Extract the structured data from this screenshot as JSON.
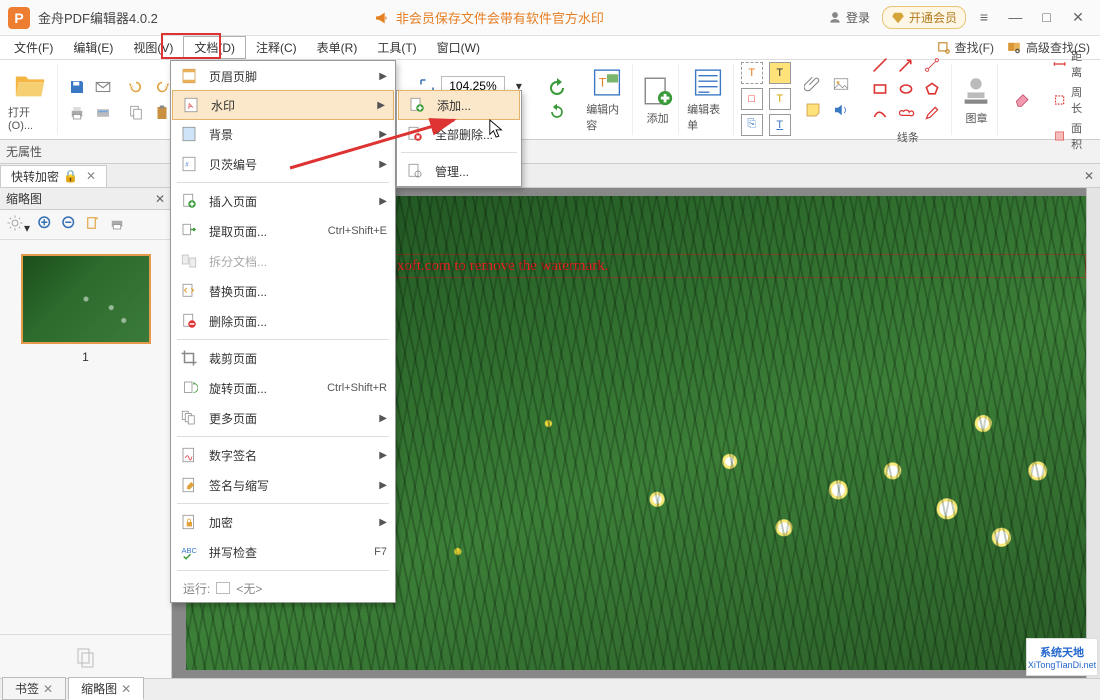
{
  "titlebar": {
    "app_title": "金舟PDF编辑器4.0.2",
    "promo_text": "非会员保存文件会带有软件官方水印",
    "login_label": "登录",
    "vip_label": "开通会员"
  },
  "menubar": {
    "items": [
      {
        "label": "文件(F)"
      },
      {
        "label": "编辑(E)"
      },
      {
        "label": "视图(V)"
      },
      {
        "label": "文档(D)"
      },
      {
        "label": "注释(C)"
      },
      {
        "label": "表单(R)"
      },
      {
        "label": "工具(T)"
      },
      {
        "label": "窗口(W)"
      }
    ],
    "find_label": "查找(F)",
    "advfind_label": "高级查找(S)"
  },
  "toolbar": {
    "open_label": "打开(O)...",
    "zoom_value": "104.25%",
    "edit_content_label": "编辑内容",
    "add_label": "添加",
    "edit_form_label": "编辑表单",
    "lines_label": "线条",
    "stamp_label": "图章",
    "distance_label": "距离",
    "perimeter_label": "周长",
    "area_label": "面积"
  },
  "propbar": {
    "text": "无属性"
  },
  "quickbar": {
    "tab_label": "快转加密"
  },
  "sidebar": {
    "head_label": "缩略图",
    "thumb_number": "1"
  },
  "document_menu": {
    "items": [
      {
        "icon": "header-footer",
        "label": "页眉页脚",
        "arrow": true
      },
      {
        "icon": "watermark",
        "label": "水印",
        "arrow": true,
        "selected": true
      },
      {
        "icon": "background",
        "label": "背景",
        "arrow": true
      },
      {
        "icon": "bates",
        "label": "贝茨编号",
        "arrow": true
      },
      {
        "sep": true
      },
      {
        "icon": "insert-page",
        "label": "插入页面",
        "arrow": true
      },
      {
        "icon": "extract-page",
        "label": "提取页面...",
        "shortcut": "Ctrl+Shift+E"
      },
      {
        "icon": "split-doc",
        "label": "拆分文档...",
        "disabled": true
      },
      {
        "icon": "replace-page",
        "label": "替换页面..."
      },
      {
        "icon": "delete-page",
        "label": "删除页面..."
      },
      {
        "sep": true
      },
      {
        "icon": "crop-page",
        "label": "裁剪页面"
      },
      {
        "icon": "rotate-page",
        "label": "旋转页面...",
        "shortcut": "Ctrl+Shift+R"
      },
      {
        "icon": "more-pages",
        "label": "更多页面",
        "arrow": true
      },
      {
        "sep": true
      },
      {
        "icon": "signature",
        "label": "数字签名",
        "arrow": true
      },
      {
        "icon": "initials",
        "label": "签名与缩写",
        "arrow": true
      },
      {
        "sep": true
      },
      {
        "icon": "encrypt",
        "label": "加密",
        "arrow": true
      },
      {
        "icon": "spellcheck",
        "label": "拼写检查",
        "shortcut": "F7"
      }
    ],
    "run_label": "运行:",
    "run_value": "<无>"
  },
  "watermark_submenu": {
    "items": [
      {
        "icon": "add",
        "label": "添加...",
        "hover": true
      },
      {
        "icon": "delete-all",
        "label": "全部删除..."
      },
      {
        "sep": true
      },
      {
        "icon": "manage",
        "label": "管理..."
      }
    ]
  },
  "page": {
    "watermark_text": "® Demo. Purchase from www.Boxoft.com to remove the watermark."
  },
  "bottom_tabs": {
    "bookmark_label": "书签",
    "thumb_label": "缩略图"
  },
  "sitebadge": {
    "line1": "系统天地",
    "line2": "XiTongTianDi.net"
  }
}
